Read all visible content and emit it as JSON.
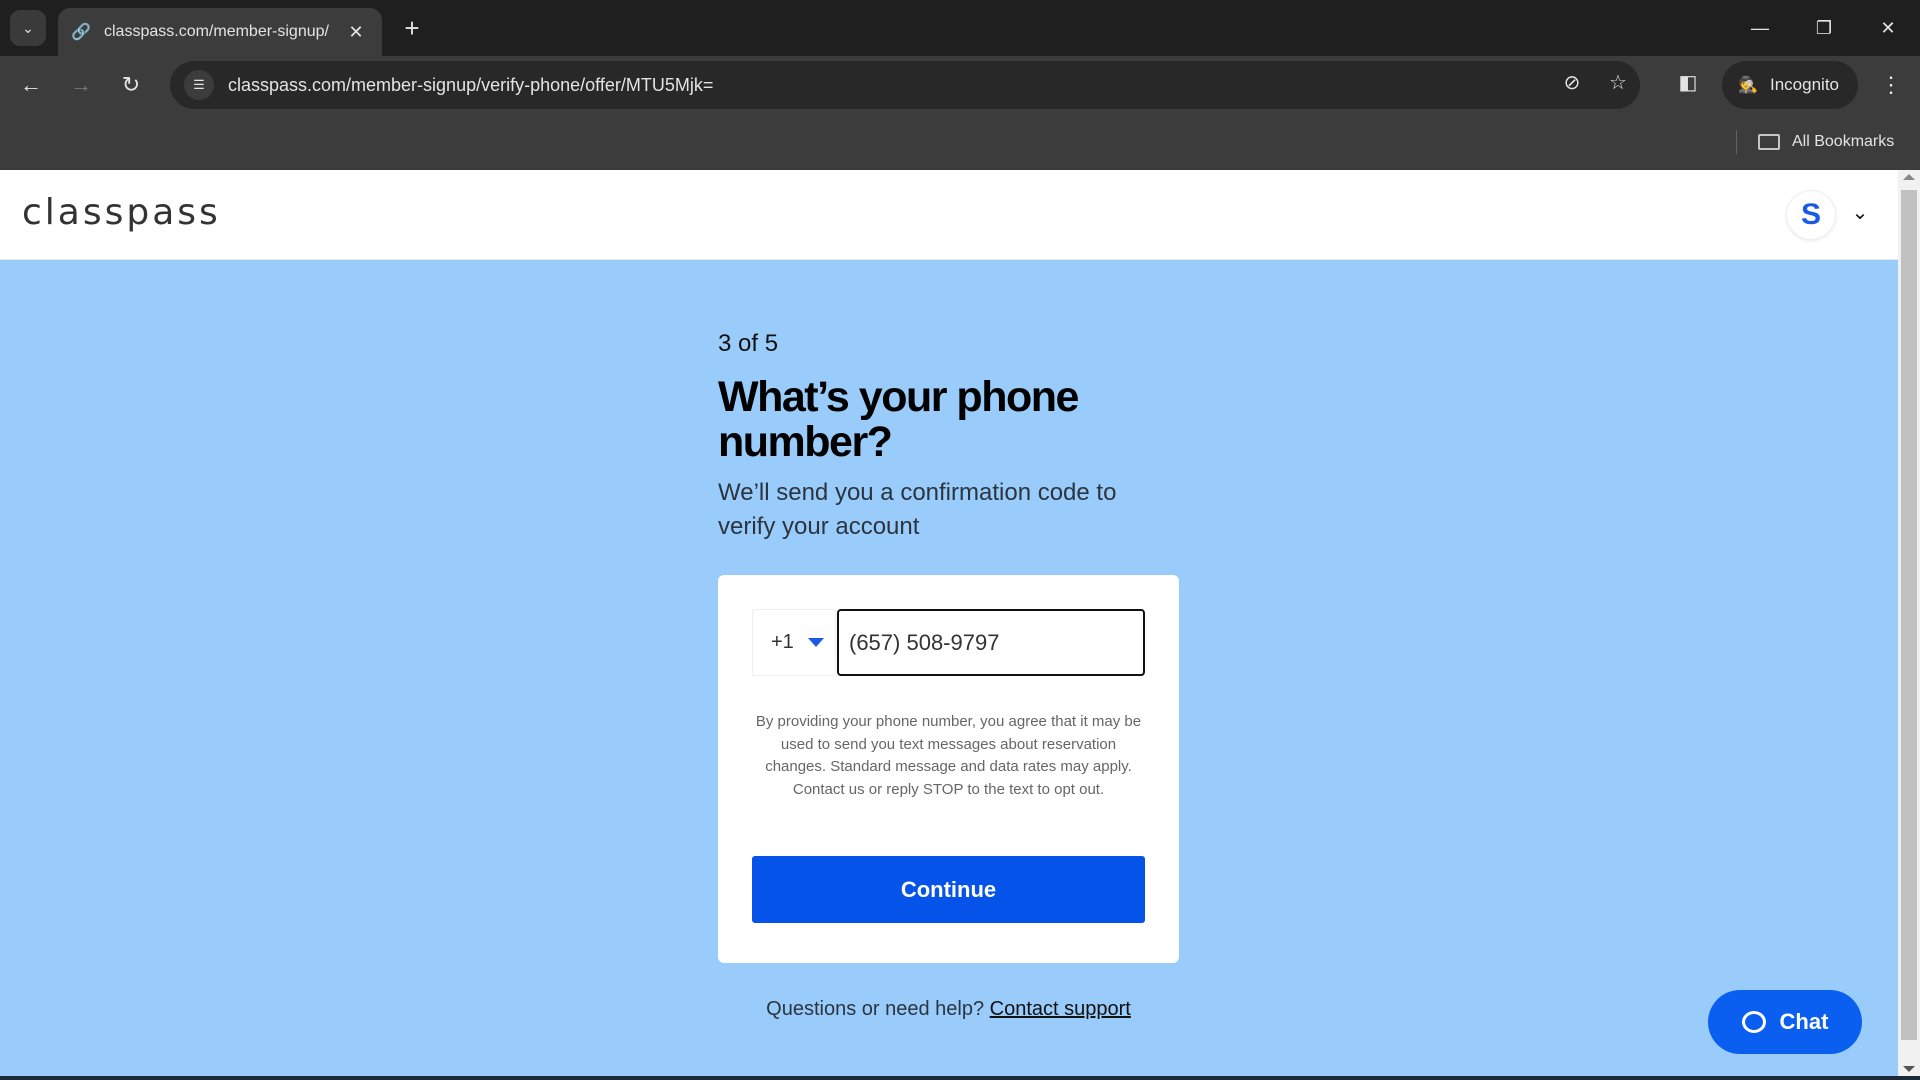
{
  "browser": {
    "tab": {
      "title": "classpass.com/member-signup/",
      "icon": "link-icon"
    },
    "url": "classpass.com/member-signup/verify-phone/offer/MTU5Mjk=",
    "incognito_label": "Incognito",
    "bookmarks_label": "All Bookmarks"
  },
  "site": {
    "logo": "classpass",
    "avatar_initial": "S",
    "brand_color": "#0553e8",
    "background_color": "#99ccfa"
  },
  "signup": {
    "step": "3 of 5",
    "heading": "What’s your phone number?",
    "subtitle": "We’ll send you a confirmation code to verify your account",
    "country_code": "+1",
    "phone_value": "(657) 508-9797",
    "disclaimer": "By providing your phone number, you agree that it may be used to send you text messages about reservation changes. Standard message and data rates may apply. Contact us or reply STOP to the text to opt out.",
    "continue_label": "Continue",
    "help_text": "Questions or need help?",
    "help_link": "Contact support"
  },
  "chat": {
    "label": "Chat"
  }
}
